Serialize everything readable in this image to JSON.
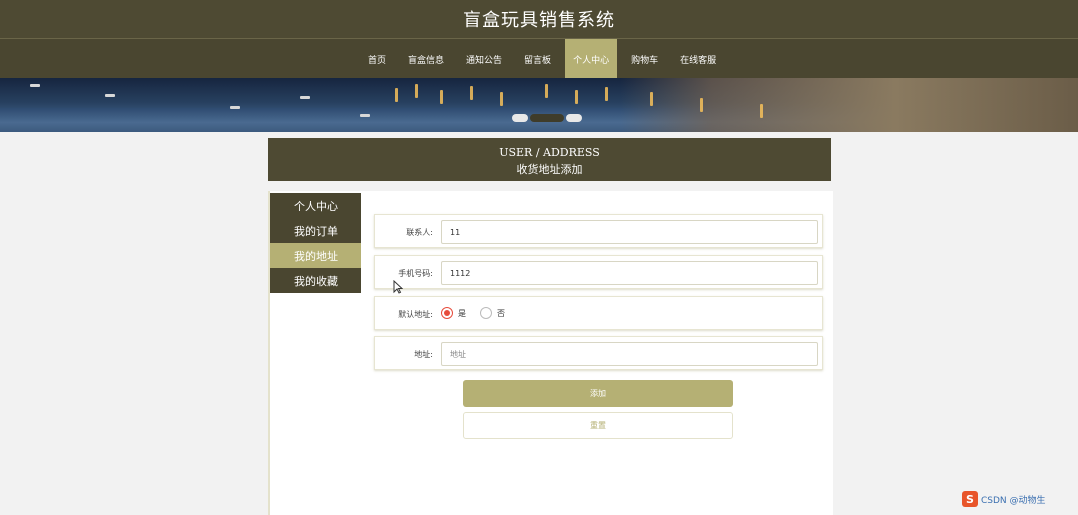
{
  "header": {
    "title": "盲盒玩具销售系统"
  },
  "nav": {
    "items": [
      {
        "label": "首页"
      },
      {
        "label": "盲盒信息"
      },
      {
        "label": "通知公告"
      },
      {
        "label": "留言板"
      },
      {
        "label": "个人中心",
        "active": true
      },
      {
        "label": "购物车"
      },
      {
        "label": "在线客服"
      }
    ]
  },
  "banner": {
    "slide_index": 2,
    "slide_count": 3
  },
  "section": {
    "title_en": "USER / ADDRESS",
    "title_cn": "收货地址添加"
  },
  "sidebar": {
    "items": [
      {
        "label": "个人中心"
      },
      {
        "label": "我的订单"
      },
      {
        "label": "我的地址",
        "active": true
      },
      {
        "label": "我的收藏"
      }
    ]
  },
  "form": {
    "contact": {
      "label": "联系人:",
      "value": "11"
    },
    "phone": {
      "label": "手机号码:",
      "value": "1112"
    },
    "default_address": {
      "label": "默认地址:",
      "options": [
        "是",
        "否"
      ],
      "selected": "是"
    },
    "address": {
      "label": "地址:",
      "placeholder": "地址"
    }
  },
  "buttons": {
    "add": "添加",
    "reset": "重置"
  },
  "watermark": {
    "logo": "S",
    "text": "CSDN @动物生"
  },
  "colors": {
    "nav_bg": "#4a4630",
    "accent": "#b5b074",
    "radio_checked": "#e74c3c"
  }
}
